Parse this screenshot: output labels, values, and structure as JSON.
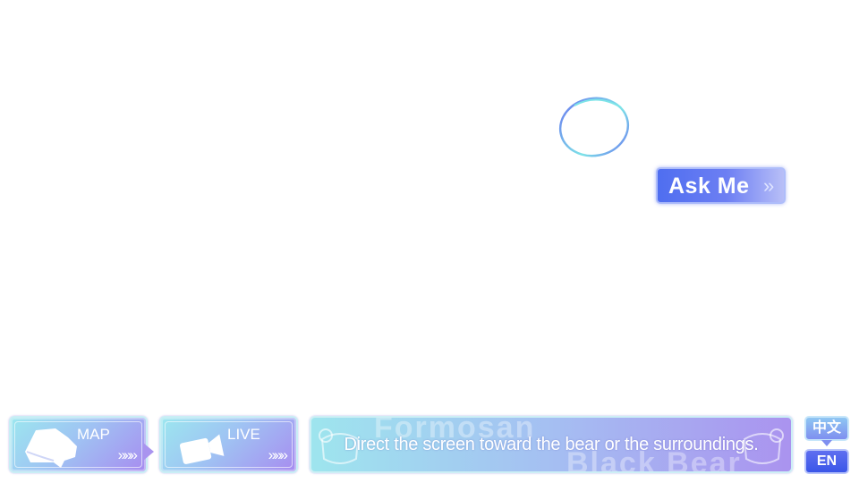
{
  "ar_view": {
    "target_ring_icon": "target-ring-icon"
  },
  "ask_button": {
    "label": "Ask Me",
    "arrow_icon": "double-chevron-right-icon"
  },
  "bottom_bar": {
    "map": {
      "label": "MAP",
      "chevrons": "»»»",
      "icon": "map-icon"
    },
    "live": {
      "label": "LIVE",
      "chevrons": "»»»",
      "icon": "camera-icon"
    },
    "banner": {
      "instruction": "Direct the screen toward the bear or the surroundings.",
      "watermark_top": "Formosan",
      "watermark_bottom": "Black Bear"
    },
    "language": {
      "zh_label": "中文",
      "en_label": "EN",
      "selected": "EN"
    }
  },
  "colors": {
    "accent_blue": "#4f6ef0",
    "banner_start": "#9ee5ee",
    "banner_end": "#aa93ef",
    "ring_cyan": "#7de3e8",
    "ring_blue": "#6a78f0"
  }
}
